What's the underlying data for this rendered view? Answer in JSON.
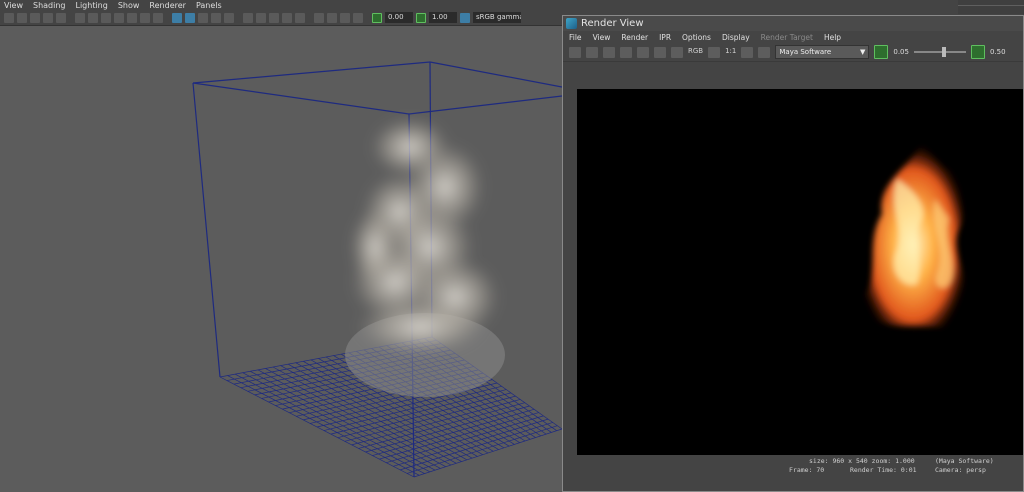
{
  "main_menu": [
    "View",
    "Shading",
    "Lighting",
    "Show",
    "Renderer",
    "Panels"
  ],
  "viewport_toolbar": {
    "exposure": "0.00",
    "gamma": "1.00",
    "color_space": "sRGB gamma"
  },
  "render_view": {
    "title": "Render View",
    "menu": [
      {
        "label": "File",
        "disabled": false
      },
      {
        "label": "View",
        "disabled": false
      },
      {
        "label": "Render",
        "disabled": false
      },
      {
        "label": "IPR",
        "disabled": false
      },
      {
        "label": "Options",
        "disabled": false
      },
      {
        "label": "Display",
        "disabled": false
      },
      {
        "label": "Render Target",
        "disabled": true
      },
      {
        "label": "Help",
        "disabled": false
      }
    ],
    "toolbar": {
      "rgb_label": "RGB",
      "ratio_label": "1:1",
      "renderer": "Maya Software",
      "exposure": "0.05",
      "gamma": "0.50"
    },
    "status": {
      "size": "size: 960 x 540  zoom: 1.000",
      "renderer": "(Maya Software)",
      "frame": "Frame: 70",
      "render_time": "Render Time: 0:01",
      "camera": "Camera: persp"
    }
  },
  "colors": {
    "wire": "#1e2a80",
    "viewport_bg": "#5c5c5c",
    "flame": "#ff8c2a"
  }
}
